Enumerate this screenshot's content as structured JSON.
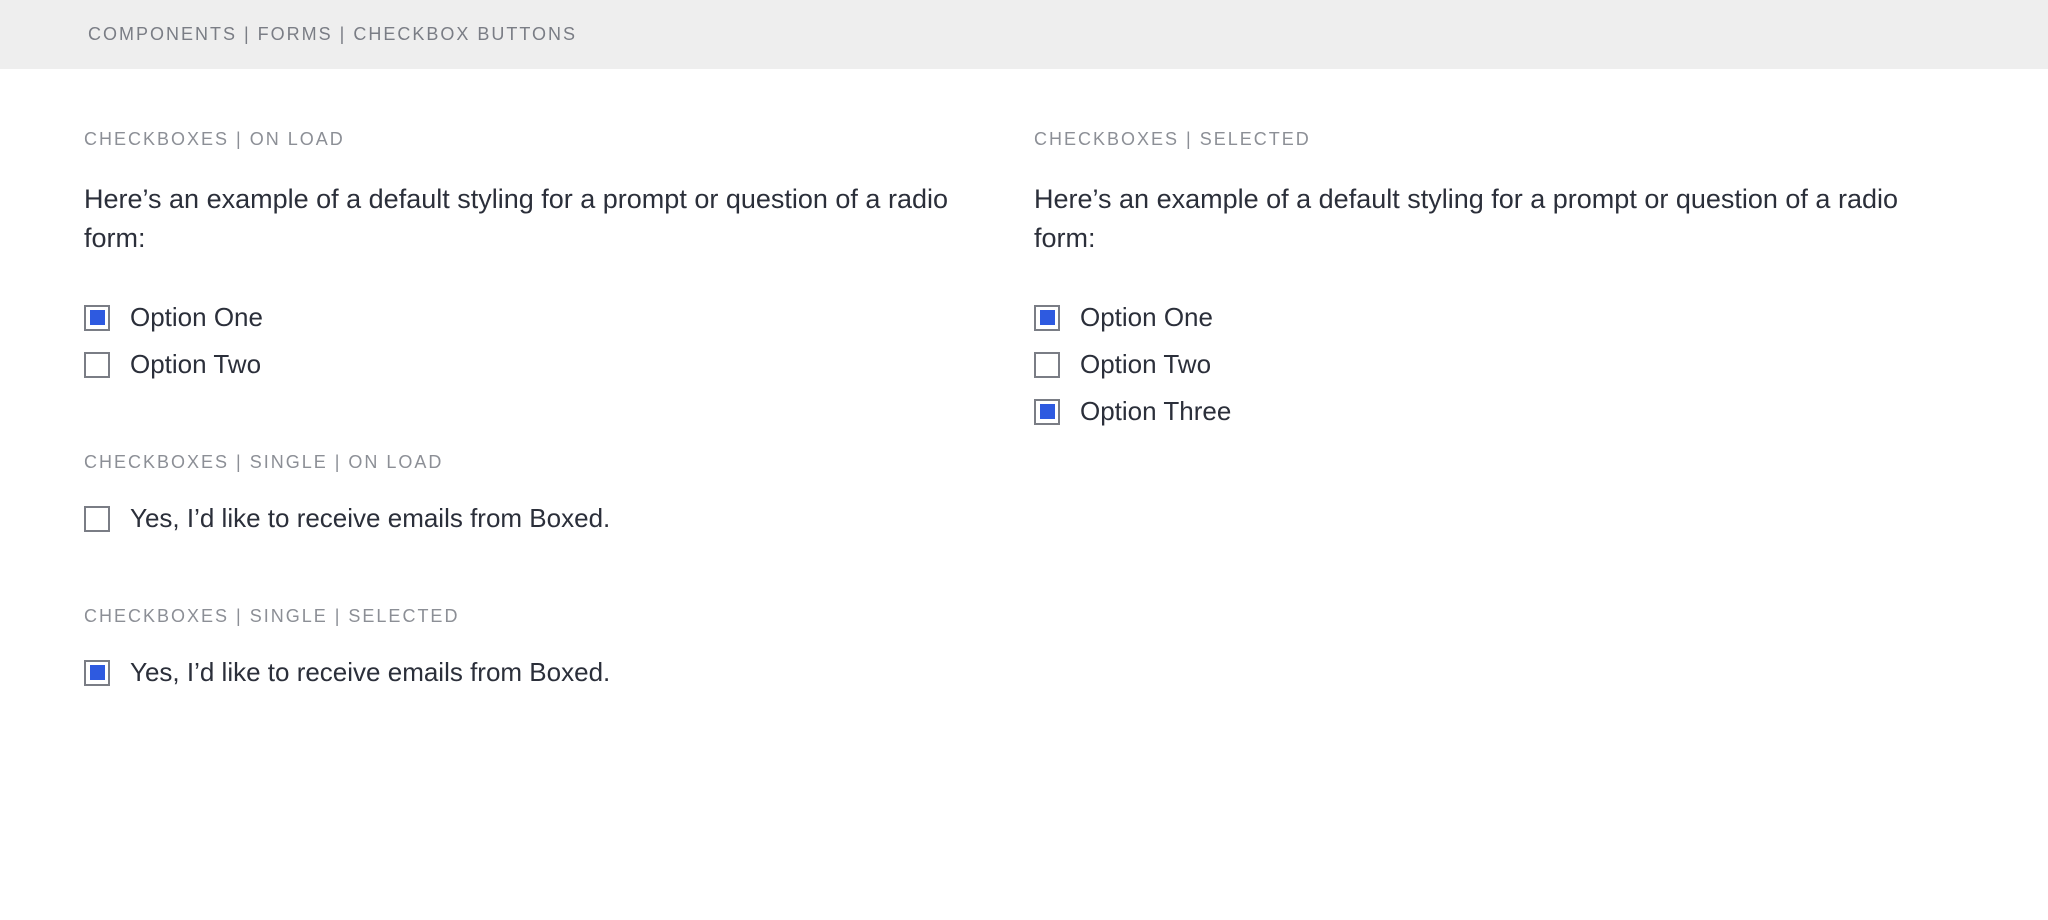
{
  "header": {
    "breadcrumb": "COMPONENTS | FORMS | CHECKBOX BUTTONS"
  },
  "left": {
    "section1": {
      "title": "CHECKBOXES | ON LOAD",
      "prompt": "Here’s an example of a default styling for a prompt or question of a radio form:",
      "options": [
        {
          "label": "Option One",
          "checked": true
        },
        {
          "label": "Option Two",
          "checked": false
        }
      ]
    },
    "section2": {
      "title": "CHECKBOXES | SINGLE | ON LOAD",
      "option": {
        "label": "Yes, I’d like to receive emails from Boxed.",
        "checked": false
      }
    },
    "section3": {
      "title": "CHECKBOXES | SINGLE | SELECTED",
      "option": {
        "label": "Yes, I’d like to receive emails from Boxed.",
        "checked": true
      }
    }
  },
  "right": {
    "section1": {
      "title": "CHECKBOXES | SELECTED",
      "prompt": "Here’s an example of a default styling for a prompt or question of a radio form:",
      "options": [
        {
          "label": "Option One",
          "checked": true
        },
        {
          "label": "Option Two",
          "checked": false
        },
        {
          "label": "Option Three",
          "checked": true
        }
      ]
    }
  }
}
